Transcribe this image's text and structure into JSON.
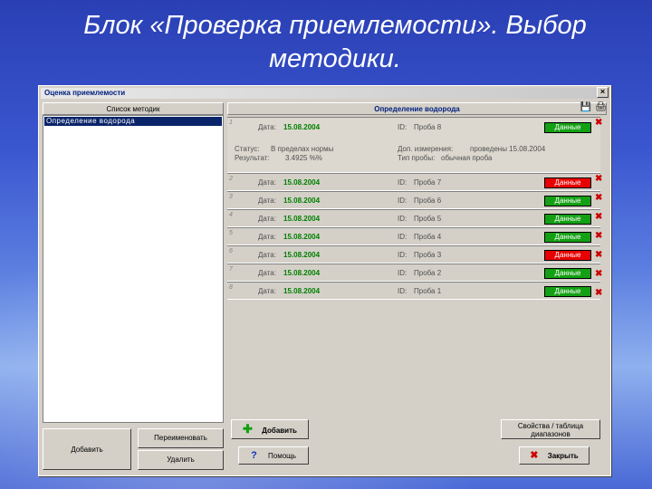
{
  "slide": {
    "title_line1": "Блок «Проверка приемлемости». Выбор",
    "title_line2": "методики."
  },
  "window": {
    "title": "Оценка приемлемости",
    "close_glyph": "×"
  },
  "left": {
    "header": "Список методик",
    "items": [
      {
        "label": "Определение водорода"
      }
    ],
    "btn_add": "Добавить",
    "btn_rename": "Переименовать",
    "btn_delete": "Удалить"
  },
  "right": {
    "header": "Определение водорода",
    "rows": [
      {
        "num": "1",
        "date_label": "Дата:",
        "date": "15.08.2004",
        "id_label": "ID:",
        "id": "Проба 8",
        "btn": "Данные",
        "btn_color": "green",
        "status_label": "Статус:",
        "status": "В пределах нормы",
        "result_label": "Результат:",
        "result": "3.4925 %%",
        "add_label": "Доп. измерения:",
        "add": "проведены 15.08.2004",
        "type_label": "Тип пробы:",
        "type": "обычная проба"
      },
      {
        "num": "2",
        "date_label": "Дата:",
        "date": "15.08.2004",
        "id_label": "ID:",
        "id": "Проба 7",
        "btn": "Данные",
        "btn_color": "red"
      },
      {
        "num": "3",
        "date_label": "Дата:",
        "date": "15.08.2004",
        "id_label": "ID:",
        "id": "Проба 6",
        "btn": "Данные",
        "btn_color": "green"
      },
      {
        "num": "4",
        "date_label": "Дата:",
        "date": "15.08.2004",
        "id_label": "ID:",
        "id": "Проба 5",
        "btn": "Данные",
        "btn_color": "green"
      },
      {
        "num": "5",
        "date_label": "Дата:",
        "date": "15.08.2004",
        "id_label": "ID:",
        "id": "Проба 4",
        "btn": "Данные",
        "btn_color": "green"
      },
      {
        "num": "6",
        "date_label": "Дата:",
        "date": "15.08.2004",
        "id_label": "ID:",
        "id": "Проба 3",
        "btn": "Данные",
        "btn_color": "red"
      },
      {
        "num": "7",
        "date_label": "Дата:",
        "date": "15.08.2004",
        "id_label": "ID:",
        "id": "Проба 2",
        "btn": "Данные",
        "btn_color": "green"
      },
      {
        "num": "8",
        "date_label": "Дата:",
        "date": "15.08.2004",
        "id_label": "ID:",
        "id": "Проба 1",
        "btn": "Данные",
        "btn_color": "green"
      }
    ],
    "btn_add": "Добавить",
    "btn_help": "Помощь",
    "btn_props": "Свойства / таблица диапазонов",
    "btn_close": "Закрыть"
  },
  "colors": {
    "green": "#14a014",
    "red": "#e80000",
    "accent": "#002080"
  },
  "icons": {
    "save": "save-icon",
    "print": "print-icon",
    "delete_row": "delete-row-icon",
    "add": "plus-icon",
    "help": "help-icon",
    "close": "close-icon"
  }
}
